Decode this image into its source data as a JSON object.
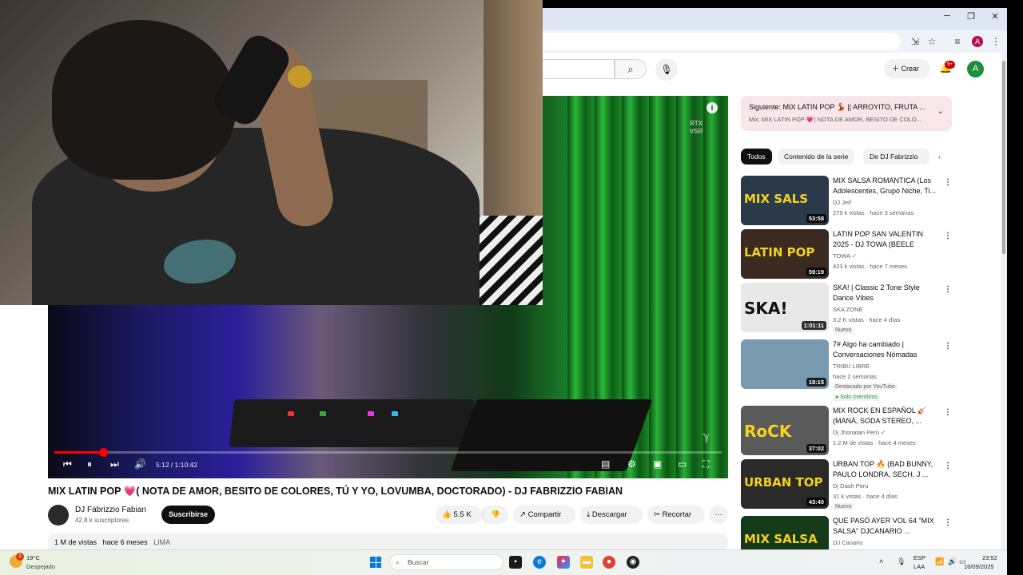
{
  "browser": {
    "window_controls": [
      "─",
      "❐",
      "✕"
    ],
    "profile_initial": "A"
  },
  "youtube_header": {
    "create_label": "Crear",
    "notifications_badge": "9+",
    "avatar_initial": "A"
  },
  "player": {
    "timecode": "5:12 / 1:10:42",
    "progress_fraction": 0.0736,
    "rtx_badge": "RTX VSR",
    "info_glyph": "i"
  },
  "video": {
    "title": "MIX LATIN POP 💗( NOTA DE AMOR, BESITO DE COLORES, TÚ Y YO, LOVUMBA, DOCTORADO) - DJ FABRIZZIO FABIAN",
    "channel_name": "DJ Fabrizzio Fabian",
    "subscribers": "42.8 k suscriptores",
    "subscribe_label": "Suscribirse",
    "likes": "5.5 K",
    "share_label": "Compartir",
    "download_label": "Descargar",
    "clip_label": "Recortar",
    "more_label": "···",
    "views": "1 M de vistas",
    "age": "hace 6 meses",
    "location": "LIMA"
  },
  "up_next": {
    "title": "Siguiente: MIX LATIN POP 💃 || ARROYITO, FRUTA ...",
    "subtitle": "Mix: MIX LATIN POP 💗( NOTA DE AMOR, BESITO DE COLO..."
  },
  "chips": [
    "Todos",
    "Contenido de la serie",
    "De DJ Fabrizzio"
  ],
  "recommendations": [
    {
      "title": "MIX SALSA ROMANTICA (Los Adolescentes, Grupo Niche, Ti...",
      "channel": "DJ Jeif",
      "meta": "279 k vistas · hace 3 semanas",
      "duration": "53:58",
      "thumb_text": "MIX SALS",
      "thumb_color": "#2a3a4a"
    },
    {
      "title": "LATIN POP SAN VALENTIN 2025 - DJ TOWA (BEELE JUAN...",
      "channel": "TOWA ✓",
      "meta": "423 k vistas · hace 7 meses",
      "duration": "59:19",
      "thumb_text": "LATIN POP",
      "thumb_color": "#3a2a22"
    },
    {
      "title": "SKA! | Classic 2 Tone Style Dance Vibes",
      "channel": "SKA ZONE",
      "meta": "3.2 K vistas · hace 4 días",
      "duration": "1:01:11",
      "thumb_text": "SKA!",
      "thumb_color": "#e8e8e8",
      "badge": "Nuevo"
    },
    {
      "title": "7# Algo ha cambiado | Conversaciones Nómadas",
      "channel": "TRIBU LIBRE",
      "meta": "hace 2 semanas",
      "duration": "18:15",
      "thumb_text": "",
      "thumb_color": "#7a9ab0",
      "badge": "Destacado por YouTube",
      "badge2": "● Solo miembros"
    },
    {
      "title": "MIX ROCK EN ESPAÑOL 🎸 (MANÁ, SODA STEREO, ...",
      "channel": "Dj Jhonatan Perú ✓",
      "meta": "1.2 M de vistas · hace 4 meses",
      "duration": "37:02",
      "thumb_text": "RoCK",
      "thumb_color": "#5a5a5a"
    },
    {
      "title": "URBAN TOP 🔥 (BAD BUNNY, PAULO LONDRA, SECH, J ...",
      "channel": "Dj Dash Peru",
      "meta": "31 k vistas · hace 4 días",
      "duration": "43:40",
      "thumb_text": "URBAN TOP",
      "thumb_color": "#2a2a2a",
      "badge": "Nuevo"
    },
    {
      "title": "QUE PASÓ AYER VOL 64 \"MIX SALSA\" DJCANARIO ...",
      "channel": "DJ Canario",
      "meta": "",
      "duration": "",
      "thumb_text": "MIX SALSA",
      "thumb_color": "#143a1a"
    }
  ],
  "taskbar": {
    "weather_badge": "2",
    "temperature": "19°C",
    "weather": "Despejado",
    "search_placeholder": "Buscar",
    "lang_top": "ESP",
    "lang_bottom": "LAA",
    "time": "23:52",
    "date": "16/09/2025"
  }
}
